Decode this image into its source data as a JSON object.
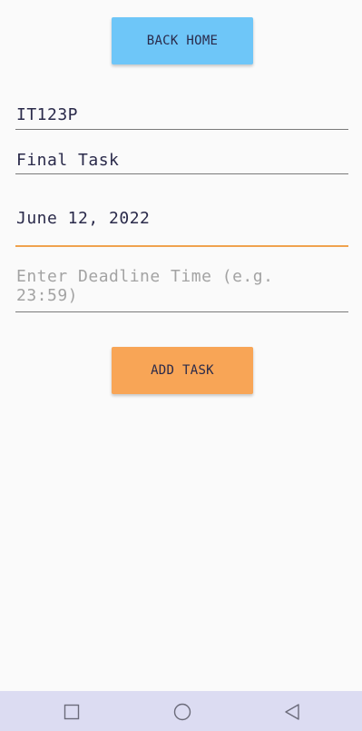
{
  "buttons": {
    "back_home": "BACK HOME",
    "add_task": "ADD TASK"
  },
  "form": {
    "course_code": "IT123P",
    "task_title": "Final Task",
    "deadline_date": "June 12, 2022",
    "deadline_time_placeholder": "Enter Deadline Time (e.g. 23:59)"
  },
  "navbar": {
    "icons": [
      "recents-square-icon",
      "home-circle-icon",
      "back-triangle-icon"
    ]
  },
  "colors": {
    "background": "#fafafa",
    "back_button": "#6ec6f8",
    "add_button": "#f8a556",
    "focus_underline": "#f0a24e",
    "navbar": "#dcdcf2",
    "text": "#2a2a4a",
    "placeholder": "#a3a3a3"
  }
}
